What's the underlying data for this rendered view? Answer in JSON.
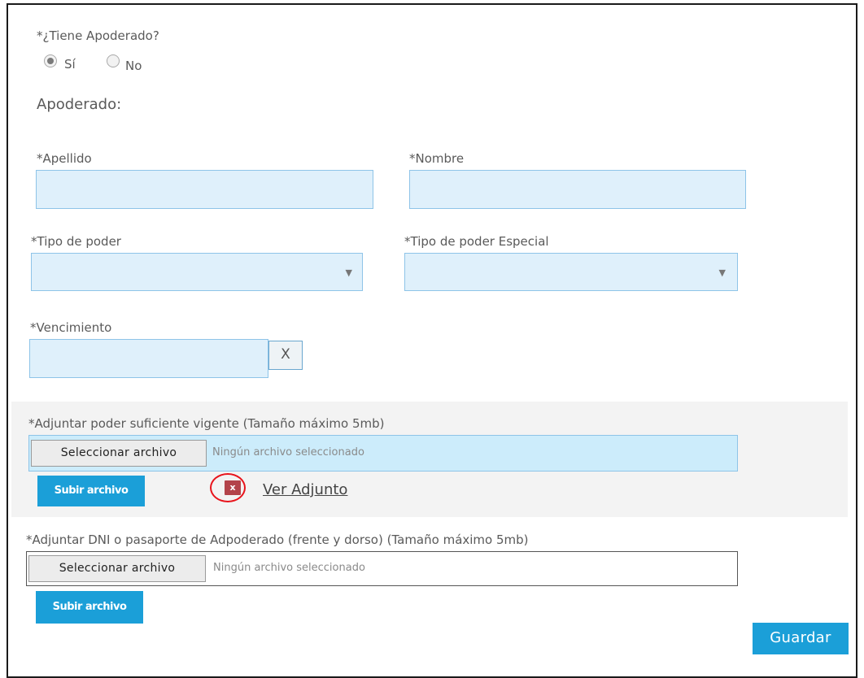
{
  "apoderado_question": {
    "label": "*¿Tiene Apoderado?",
    "options": [
      {
        "label": "Sí",
        "checked": true
      },
      {
        "label": "No",
        "checked": false
      }
    ]
  },
  "section_title": "Apoderado:",
  "fields": {
    "apellido": {
      "label": "*Apellido",
      "value": ""
    },
    "nombre": {
      "label": "*Nombre",
      "value": ""
    },
    "tipo_poder": {
      "label": "*Tipo de poder",
      "selected": ""
    },
    "tipo_poder_especial": {
      "label": "*Tipo de poder Especial",
      "selected": ""
    },
    "vencimiento": {
      "label": "*Vencimiento",
      "value": "",
      "clear_label": "X"
    }
  },
  "attachment_poder": {
    "label": "*Adjuntar poder suficiente vigente (Tamaño máximo 5mb)",
    "choose_label": "Seleccionar archivo",
    "status": "Ningún archivo seleccionado",
    "upload_label": "Subir archivo",
    "delete_label": "x",
    "view_link": "Ver Adjunto"
  },
  "attachment_dni": {
    "label": "*Adjuntar DNI o pasaporte de Adpoderado (frente y dorso) (Tamaño máximo 5mb)",
    "choose_label": "Seleccionar archivo",
    "status": "Ningún archivo seleccionado",
    "upload_label": "Subir archivo"
  },
  "save_label": "Guardar",
  "colors": {
    "input_bg": "#dff0fb",
    "input_border": "#8ec4e8",
    "primary_button": "#1b9fd8",
    "delete_icon": "#b3434a",
    "highlight_circle": "#e8131b"
  }
}
